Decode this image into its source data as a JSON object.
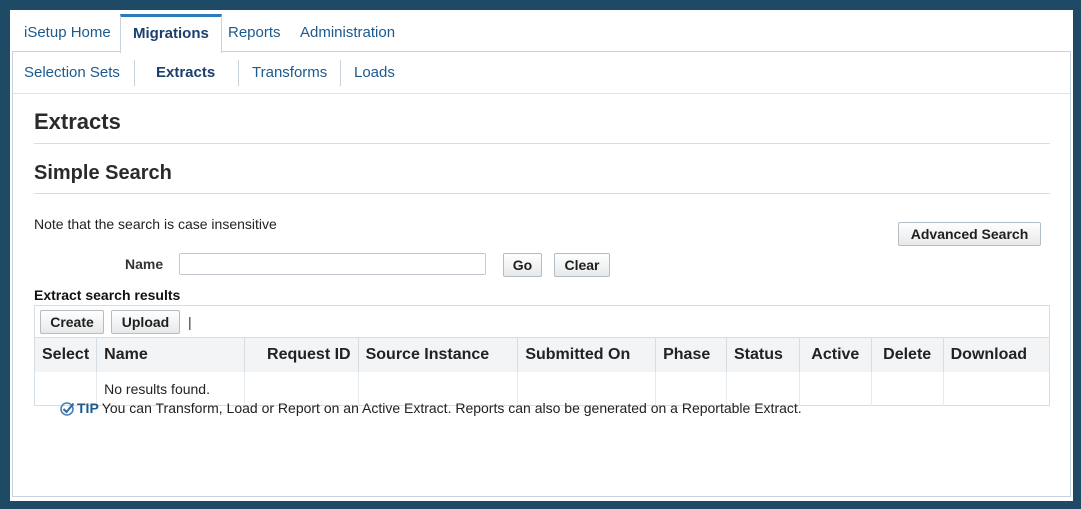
{
  "tabs": [
    {
      "label": "iSetup Home",
      "active": false
    },
    {
      "label": "Migrations",
      "active": true
    },
    {
      "label": "Reports",
      "active": false
    },
    {
      "label": "Administration",
      "active": false
    }
  ],
  "subnav": [
    {
      "label": "Selection Sets",
      "active": false
    },
    {
      "label": "Extracts",
      "active": true
    },
    {
      "label": "Transforms",
      "active": false
    },
    {
      "label": "Loads",
      "active": false
    }
  ],
  "page": {
    "title": "Extracts",
    "section_title": "Simple Search",
    "note": "Note that the search is case insensitive"
  },
  "search": {
    "advanced_label": "Advanced Search",
    "name_label": "Name",
    "name_value": "",
    "go_label": "Go",
    "clear_label": "Clear"
  },
  "results": {
    "title": "Extract search results",
    "create_label": "Create",
    "upload_label": "Upload",
    "toolbar_separator": "|",
    "columns": [
      "Select",
      "Name",
      "Request ID",
      "Source Instance",
      "Submitted On",
      "Phase",
      "Status",
      "Active",
      "Delete",
      "Download"
    ],
    "empty_message": "No results found."
  },
  "tip": {
    "label": "TIP",
    "text": "You can Transform, Load or Report on an Active Extract. Reports can also be generated on a Reportable Extract."
  },
  "colors": {
    "frame": "#1e4a66",
    "link": "#1c5a8e",
    "active_tab_border": "#2b7bbd"
  }
}
